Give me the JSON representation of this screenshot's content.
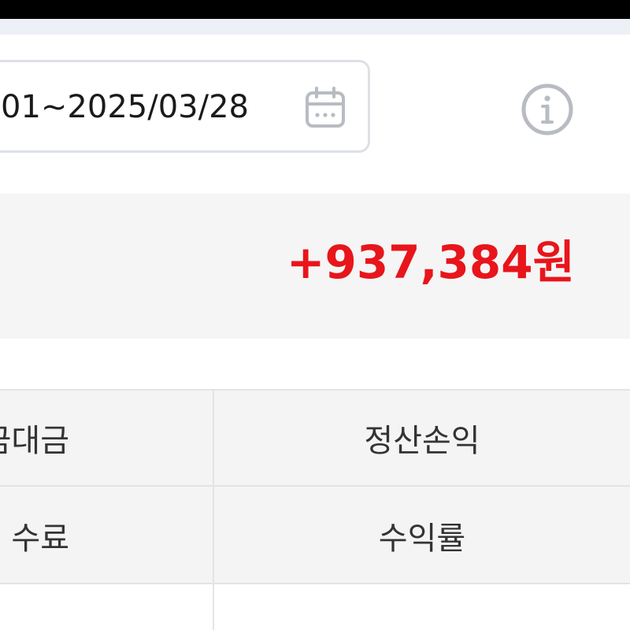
{
  "date_filter": {
    "range_text": "01~2025/03/28",
    "calendar_icon": "calendar-icon"
  },
  "info_icon": "info-icon",
  "summary": {
    "amount": "+937,384원",
    "amount_color": "#e8151b"
  },
  "table": {
    "header_row_1": {
      "left": "금대금",
      "right": "정산손익"
    },
    "header_row_2": {
      "left": "수료",
      "right": "수익률"
    }
  },
  "colors": {
    "header_bg": "#f4f4f4",
    "summary_bg": "#f5f5f5",
    "border": "#dde1e6",
    "icon_gray": "#b8bcc2"
  }
}
